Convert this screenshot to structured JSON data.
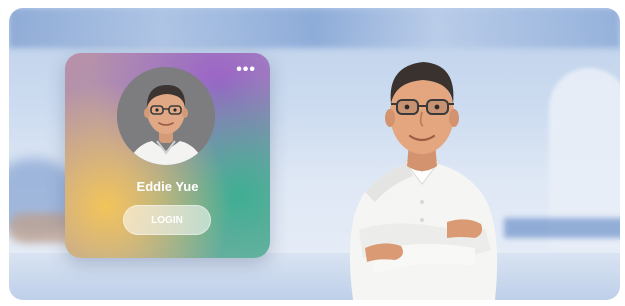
{
  "card": {
    "more_label": "•••",
    "username": "Eddie Yue",
    "login_label": "LOGIN"
  },
  "icons": [
    "more-icon",
    "avatar-portrait",
    "character-illustration"
  ],
  "colors": {
    "card_yellow": "#f2c45a",
    "card_purple": "#9b63c7",
    "card_green": "#3fae92",
    "shirt": "#f5f5f3",
    "background_blue": "#bdd0ea"
  }
}
